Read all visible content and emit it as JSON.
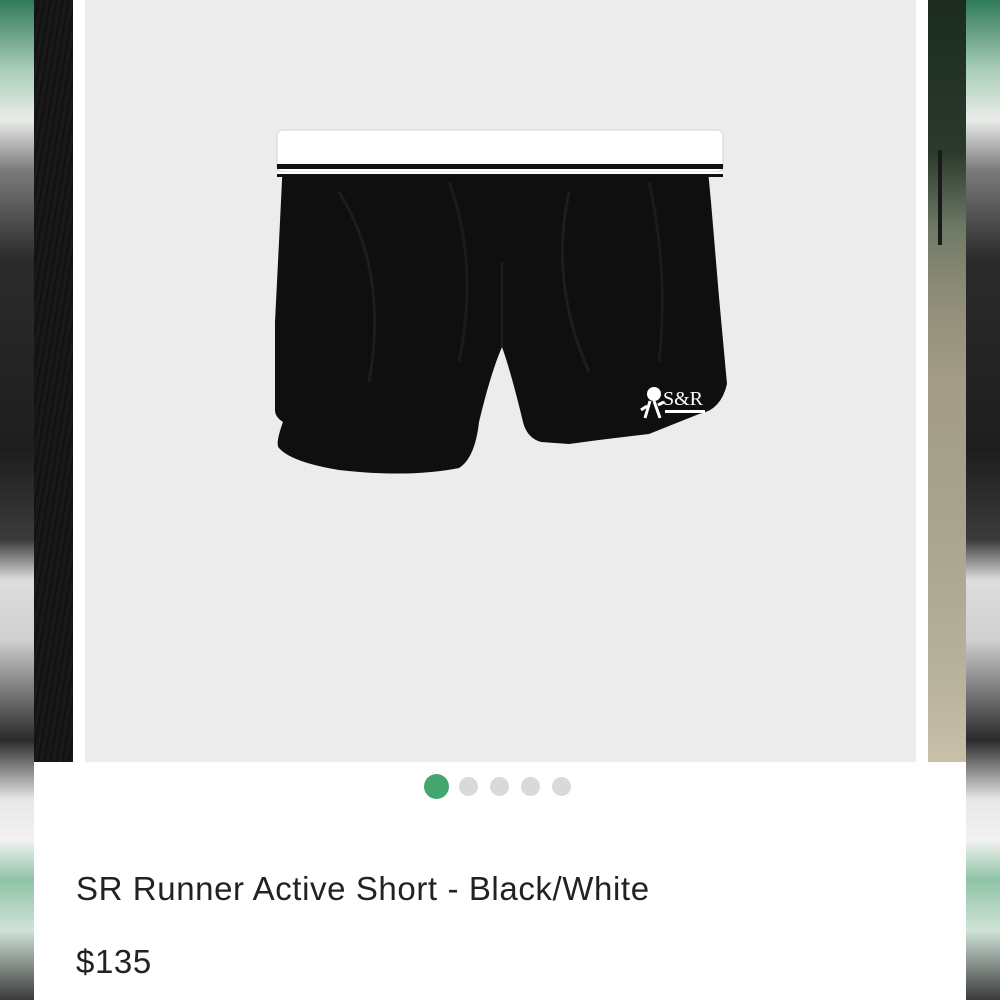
{
  "product": {
    "title": "SR Runner Active Short - Black/White",
    "price": "$135",
    "image_icon": "black-shorts-with-white-waistband",
    "logo_text": "S&R"
  },
  "carousel": {
    "slide_count": 5,
    "active_index": 0,
    "active_dot_color": "#43a66f",
    "inactive_dot_color": "#d9d9d9"
  }
}
